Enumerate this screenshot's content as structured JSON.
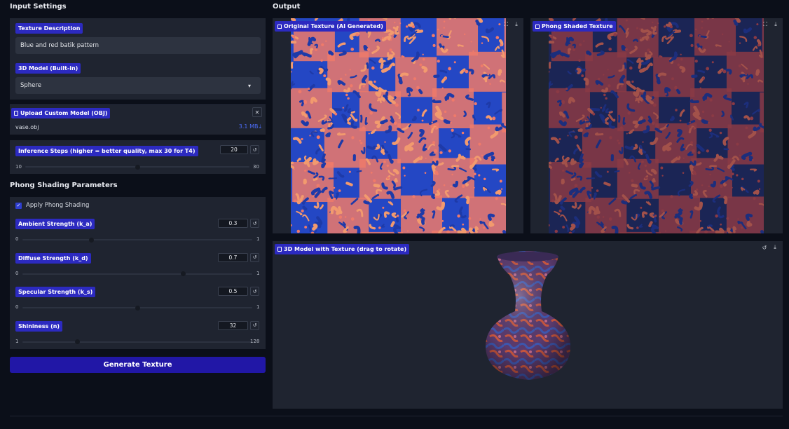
{
  "input_settings": {
    "heading": "Input Settings",
    "texture_description": {
      "label": "Texture Description",
      "value": "Blue and red batik pattern"
    },
    "model": {
      "label": "3D Model (Built-in)",
      "value": "Sphere"
    },
    "upload": {
      "label": "Upload Custom Model (OBJ)",
      "file_name": "vase.obj",
      "file_size": "3.1 MB",
      "close_icon": "close-icon"
    },
    "inference": {
      "label": "Inference Steps (higher = better quality, max 30 for T4)",
      "value": "20",
      "min": "10",
      "max": "30",
      "level": 0.5
    }
  },
  "phong": {
    "heading": "Phong Shading Parameters",
    "apply_label": "Apply Phong Shading",
    "apply_checked": true,
    "sliders": [
      {
        "label": "Ambient Strength (k_a)",
        "value": "0.3",
        "min": "0",
        "max": "1",
        "level": 0.3
      },
      {
        "label": "Diffuse Strength (k_d)",
        "value": "0.7",
        "min": "0",
        "max": "1",
        "level": 0.7
      },
      {
        "label": "Specular Strength (k_s)",
        "value": "0.5",
        "min": "0",
        "max": "1",
        "level": 0.5
      },
      {
        "label": "Shininess (n)",
        "value": "32",
        "min": "1",
        "max": "128",
        "level": 0.24
      }
    ]
  },
  "generate_button": "Generate Texture",
  "output": {
    "heading": "Output",
    "original_texture_label": "Original Texture (AI Generated)",
    "phong_texture_label": "Phong Shaded Texture",
    "model_view_label": "3D Model with Texture (drag to rotate)"
  },
  "colors": {
    "accent": "#2c2ac0",
    "button": "#2117a6",
    "panel": "#1f2430",
    "background": "#0b0f19",
    "texture_red": "#e86b63",
    "texture_blue": "#1f3fb8"
  },
  "icons": {
    "reset": "↺",
    "close": "✕",
    "download": "⤓",
    "fullscreen": "⛶",
    "dropdown": "▾",
    "check": "✓"
  }
}
